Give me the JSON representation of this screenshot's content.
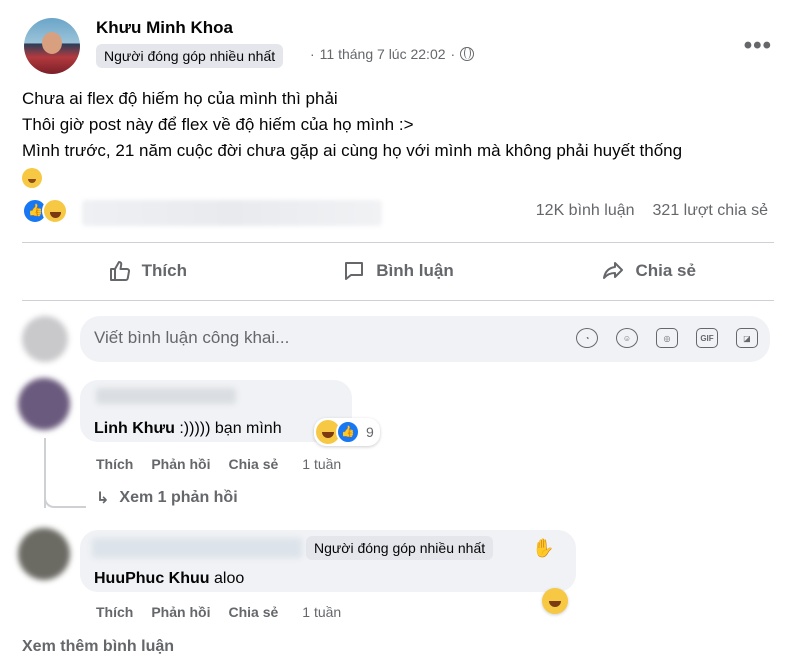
{
  "post": {
    "author": "Khưu Minh Khoa",
    "badge": "Người đóng góp nhiều nhất",
    "timestamp": "11 tháng 7 lúc 22:02",
    "privacy_icon": "globe-icon",
    "more_icon": "ellipsis-icon",
    "text_lines": [
      "Chưa ai flex độ hiếm họ của mình thì phải",
      "Thôi giờ post này để flex về độ hiếm của họ mình :>",
      "Mình trước, 21 năm cuộc đời chưa gặp ai cùng họ với mình mà không phải huyết thống"
    ],
    "trailing_emoji": "grinning-face-emoji"
  },
  "stats": {
    "reactions": [
      "like",
      "haha"
    ],
    "comments": "12K bình luận",
    "shares": "321 lượt chia sẻ"
  },
  "actions": {
    "like": "Thích",
    "comment": "Bình luận",
    "share": "Chia sẻ"
  },
  "composer": {
    "placeholder": "Viết bình luận công khai...",
    "icons": [
      "sticker-avatar-icon",
      "emoji-icon",
      "camera-icon",
      "gif-icon",
      "sticker-icon"
    ],
    "gif_label": "GIF"
  },
  "comments": [
    {
      "name": "Linh Khưu",
      "text": ":))))) bạn mình",
      "reaction_count": "9",
      "actions": {
        "like": "Thích",
        "reply": "Phản hồi",
        "share": "Chia sẻ",
        "time": "1 tuần"
      },
      "view_replies": "Xem 1 phản hồi"
    },
    {
      "name": "HuuPhuc Khuu",
      "text": "aloo",
      "badge": "Người đóng góp nhiều nhất",
      "actions": {
        "like": "Thích",
        "reply": "Phản hồi",
        "share": "Chia sẻ",
        "time": "1 tuần"
      }
    }
  ],
  "more_comments": "Xem thêm bình luận"
}
